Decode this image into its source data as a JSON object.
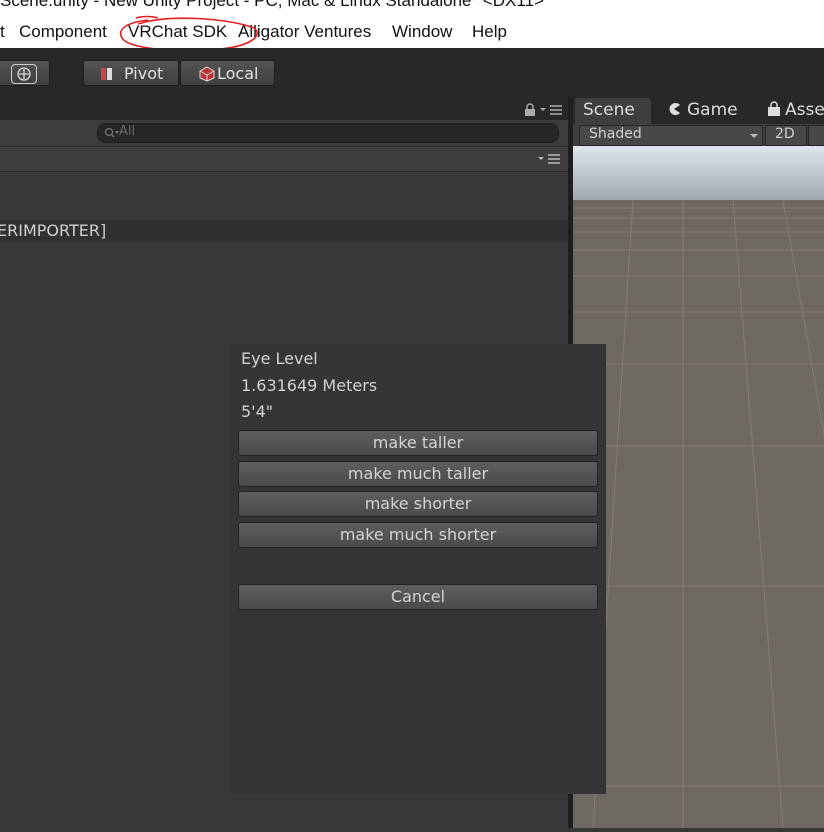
{
  "window": {
    "title": "Scene.unity - New Unity Project - PC, Mac & Linux Standalone* <DX11>"
  },
  "menu": {
    "items": [
      "t",
      "Component",
      "VRChat SDK",
      "Alligator Ventures",
      "Window",
      "Help"
    ],
    "highlighted": "VRChat SDK",
    "highlight_color": "#e02020"
  },
  "toolbar": {
    "pivot_label": "Pivot",
    "local_label": "Local"
  },
  "hierarchy": {
    "search_placeholder": "All",
    "row_label": "ERIMPORTER]"
  },
  "scene_tabs": {
    "scene": "Scene",
    "game": "Game",
    "asset": "Asse",
    "shading_mode": "Shaded",
    "mode_2d": "2D"
  },
  "dialog": {
    "title": "Eye Level",
    "meters": "1.631649 Meters",
    "feet": "5'4\"",
    "buttons": {
      "taller": "make taller",
      "much_taller": "make much taller",
      "shorter": "make shorter",
      "much_shorter": "make much shorter",
      "cancel": "Cancel"
    }
  },
  "colors": {
    "editor_dark": "#383838",
    "toolbar_dark": "#282828",
    "dialog_bg": "#353535",
    "ground": "#6e6862",
    "sky": "#c8ccd2"
  }
}
